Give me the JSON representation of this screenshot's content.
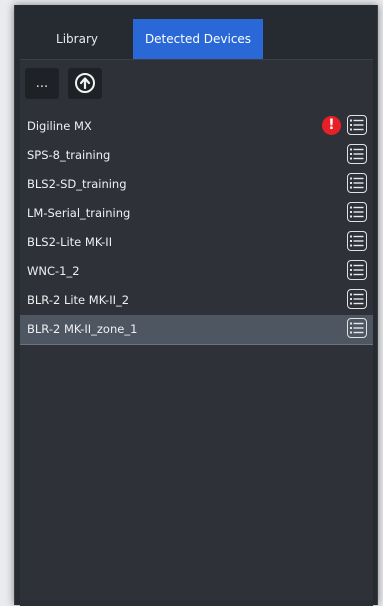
{
  "tabs": {
    "library": "Library",
    "detected": "Detected Devices"
  },
  "toolbar": {
    "more_label": "...",
    "upload_icon": "upload-circle-icon"
  },
  "devices": [
    {
      "name": "Digiline MX",
      "alert": true
    },
    {
      "name": "SPS-8_training",
      "alert": false
    },
    {
      "name": "BLS2-SD_training",
      "alert": false
    },
    {
      "name": "LM-Serial_training",
      "alert": false
    },
    {
      "name": "BLS2-Lite MK-II",
      "alert": false
    },
    {
      "name": "WNC-1_2",
      "alert": false
    },
    {
      "name": "BLR-2 Lite MK-II_2",
      "alert": false
    },
    {
      "name": "BLR-2 MK-II_zone_1",
      "alert": false,
      "selected": true
    }
  ],
  "alert_symbol": "!",
  "colors": {
    "accent": "#2a68d8",
    "alert": "#e81f26",
    "panel": "#262b31",
    "list_bg": "#2e3238",
    "selected_row": "#4e5662"
  }
}
